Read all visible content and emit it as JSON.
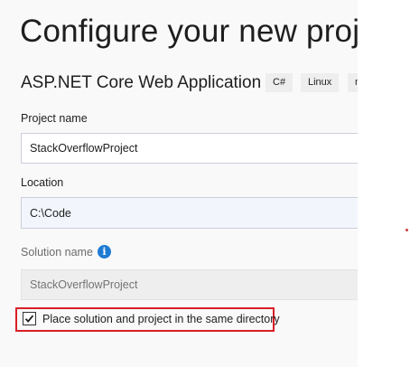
{
  "header": {
    "title": "Configure your new project",
    "template_name": "ASP.NET Core Web Application",
    "tags": [
      "C#",
      "Linux",
      "macOS"
    ]
  },
  "form": {
    "project_name": {
      "label": "Project name",
      "value": "StackOverflowProject"
    },
    "location": {
      "label": "Location",
      "value": "C:\\Code"
    },
    "solution_name": {
      "label": "Solution name",
      "placeholder": "StackOverflowProject",
      "info_icon": "info-icon"
    },
    "same_directory": {
      "label": "Place solution and project in the same directory",
      "checked": true
    }
  },
  "colors": {
    "highlight_border": "#d81e27",
    "info_icon": "#1e7bd4"
  }
}
